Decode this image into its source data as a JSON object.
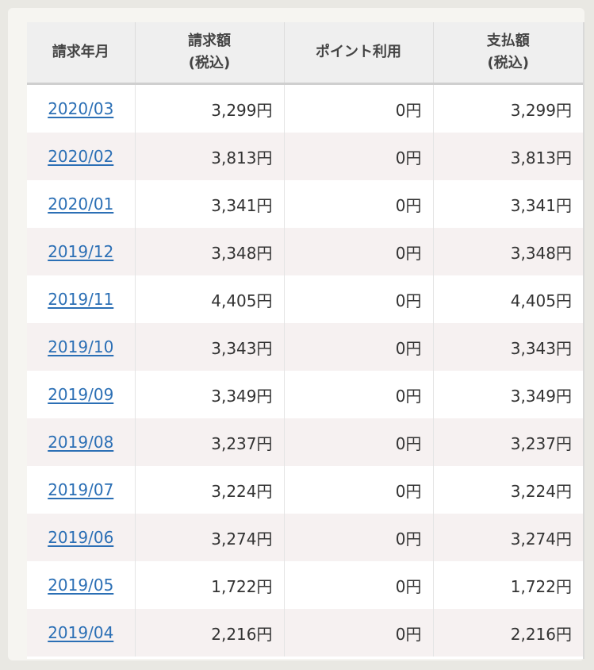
{
  "table": {
    "headers": {
      "month": "請求年月",
      "billed_line1": "請求額",
      "billed_line2": "(税込)",
      "points": "ポイント利用",
      "paid_line1": "支払額",
      "paid_line2": "(税込)"
    },
    "rows": [
      {
        "month": "2020/03",
        "billed": "3,299円",
        "points": "0円",
        "paid": "3,299円"
      },
      {
        "month": "2020/02",
        "billed": "3,813円",
        "points": "0円",
        "paid": "3,813円"
      },
      {
        "month": "2020/01",
        "billed": "3,341円",
        "points": "0円",
        "paid": "3,341円"
      },
      {
        "month": "2019/12",
        "billed": "3,348円",
        "points": "0円",
        "paid": "3,348円"
      },
      {
        "month": "2019/11",
        "billed": "4,405円",
        "points": "0円",
        "paid": "4,405円"
      },
      {
        "month": "2019/10",
        "billed": "3,343円",
        "points": "0円",
        "paid": "3,343円"
      },
      {
        "month": "2019/09",
        "billed": "3,349円",
        "points": "0円",
        "paid": "3,349円"
      },
      {
        "month": "2019/08",
        "billed": "3,237円",
        "points": "0円",
        "paid": "3,237円"
      },
      {
        "month": "2019/07",
        "billed": "3,224円",
        "points": "0円",
        "paid": "3,224円"
      },
      {
        "month": "2019/06",
        "billed": "3,274円",
        "points": "0円",
        "paid": "3,274円"
      },
      {
        "month": "2019/05",
        "billed": "1,722円",
        "points": "0円",
        "paid": "1,722円"
      },
      {
        "month": "2019/04",
        "billed": "2,216円",
        "points": "0円",
        "paid": "2,216円"
      }
    ]
  },
  "colors": {
    "link": "#2b6fb5",
    "header_bg": "#efefef",
    "row_alt_bg": "#f6f1f1"
  }
}
